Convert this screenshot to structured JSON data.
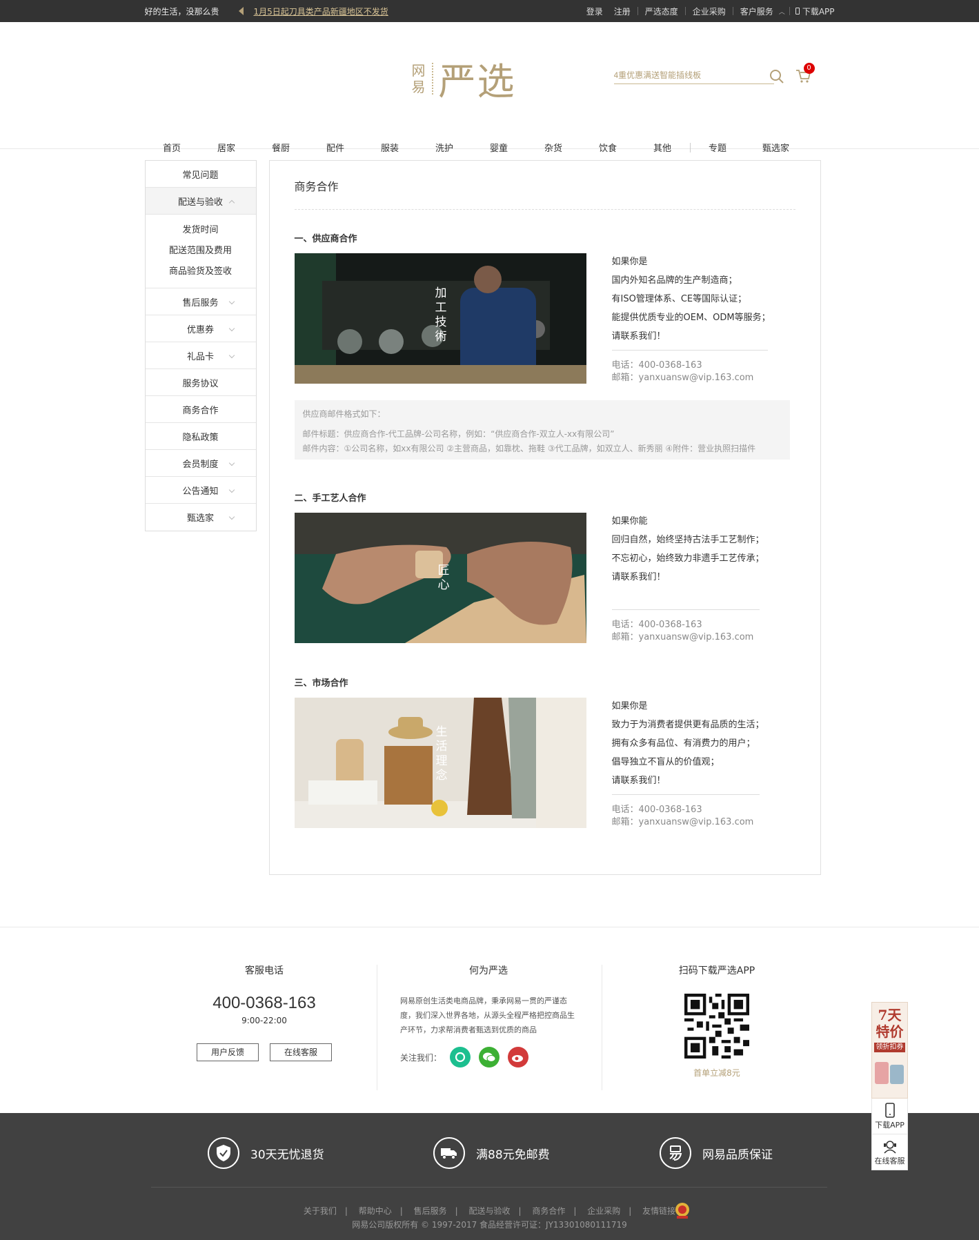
{
  "topbar": {
    "slogan": "好的生活，没那么贵",
    "notice": "1月5日起刀具类产品新疆地区不发货",
    "links": [
      "登录",
      "注册",
      "严选态度",
      "企业采购",
      "客户服务",
      "下载APP"
    ]
  },
  "header": {
    "logo_small": "网易",
    "logo_big": "严选",
    "search_placeholder": "4重优惠满送智能插线板",
    "cart_count": "0"
  },
  "nav": [
    "首页",
    "居家",
    "餐厨",
    "配件",
    "服装",
    "洗护",
    "婴童",
    "杂货",
    "饮食",
    "其他",
    "专题",
    "甄选家"
  ],
  "sidebar": {
    "items_top": [
      "常见问题",
      "配送与验收"
    ],
    "sub": [
      "发货时间",
      "配送范围及费用",
      "商品验货及签收"
    ],
    "items_bottom": [
      "售后服务",
      "优惠券",
      "礼品卡",
      "服务协议",
      "商务合作",
      "隐私政策",
      "会员制度",
      "公告通知",
      "甄选家"
    ]
  },
  "main": {
    "title": "商务合作",
    "sections": [
      {
        "title": "一、供应商合作",
        "img_label": "加工技術",
        "lines": [
          "如果你是",
          "国内外知名品牌的生产制造商；",
          "有ISO管理体系、CE等国际认证；",
          "能提供优质专业的OEM、ODM等服务；",
          "请联系我们！"
        ],
        "phone": "电话：400-0368-163",
        "email": "邮箱：yanxuansw@vip.163.com"
      },
      {
        "title": "二、手工艺人合作",
        "img_label": "匠心",
        "lines": [
          "如果你能",
          "回归自然，始终坚持古法手工艺制作；",
          "不忘初心，始终致力非遗手工艺传承；",
          "请联系我们！"
        ],
        "phone": "电话：400-0368-163",
        "email": "邮箱：yanxuansw@vip.163.com"
      },
      {
        "title": "三、市场合作",
        "img_label": "生活理念",
        "lines": [
          "如果你是",
          "致力于为消费者提供更有品质的生活；",
          "拥有众多有品位、有消费力的用户；",
          "倡导独立不盲从的价值观；",
          "请联系我们！"
        ],
        "phone": "电话：400-0368-163",
        "email": "邮箱：yanxuansw@vip.163.com"
      }
    ],
    "info": {
      "heading": "供应商邮件格式如下：",
      "subject": "邮件标题：供应商合作-代工品牌-公司名称，例如：“供应商合作-双立人-xx有限公司”",
      "content": "邮件内容：①公司名称，如xx有限公司 ②主营商品，如靠枕、拖鞋 ③代工品牌，如双立人、新秀丽 ④附件：营业执照扫描件"
    }
  },
  "footer": {
    "service_title": "客服电话",
    "service_phone": "400-0368-163",
    "service_hours": "9:00-22:00",
    "btn_feedback": "用户反馈",
    "btn_online": "在线客服",
    "about_title": "何为严选",
    "about_desc": "网易原创生活类电商品牌，秉承网易一贯的严谨态度，我们深入世界各地，从源头全程严格把控商品生产环节，力求帮消费者甄选到优质的商品",
    "follow_label": "关注我们：",
    "app_title": "扫码下载严选APP",
    "app_note": "首单立减8元",
    "promises": [
      "30天无忧退货",
      "满88元免邮费",
      "网易品质保证"
    ],
    "links": [
      "关于我们",
      "帮助中心",
      "售后服务",
      "配送与验收",
      "商务合作",
      "企业采购",
      "友情链接"
    ],
    "copyright": "网易公司版权所有 © 1997-2017   食品经营许可证：JY13301080111719"
  },
  "float": {
    "promo_title": "7天特价",
    "promo_tag": "领折扣券",
    "download": "下载APP",
    "service": "在线客服"
  },
  "colors": {
    "brand": "#b4a078",
    "topbar": "#333333",
    "footer_dark": "#414141",
    "badge": "#dd0000"
  }
}
